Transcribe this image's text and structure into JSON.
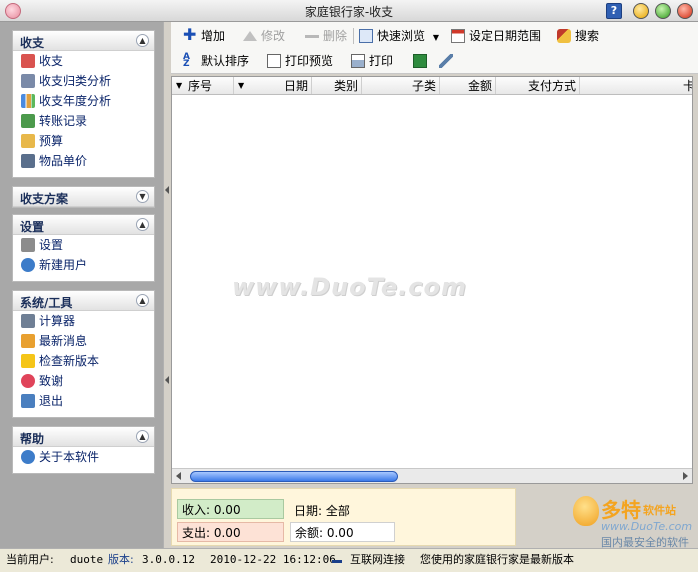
{
  "window": {
    "title": "家庭银行家-收支",
    "help_glyph": "?"
  },
  "sidebar": {
    "panels": [
      {
        "title": "收支",
        "items": [
          "收支",
          "收支归类分析",
          "收支年度分析",
          "转账记录",
          "预算",
          "物品单价"
        ]
      },
      {
        "title": "收支方案",
        "items": []
      },
      {
        "title": "设置",
        "items": [
          "设置",
          "新建用户"
        ]
      },
      {
        "title": "系统/工具",
        "items": [
          "计算器",
          "最新消息",
          "检查新版本",
          "致谢",
          "退出"
        ]
      },
      {
        "title": "帮助",
        "items": [
          "关于本软件"
        ]
      }
    ]
  },
  "toolbar": {
    "add": "增加",
    "edit": "修改",
    "delete": "删除",
    "quick_browse": "快速浏览",
    "date_range": "设定日期范围",
    "search": "搜索",
    "default_sort": "默认排序",
    "print_preview": "打印预览",
    "print": "打印"
  },
  "grid": {
    "columns": [
      "序号",
      "日期",
      "类别",
      "子类",
      "金额",
      "支付方式",
      "卡种"
    ]
  },
  "watermark": "www.DuoTe.com",
  "summary": {
    "income": "收入: 0.00",
    "expense": "支出: 0.00",
    "date": "日期: 全部",
    "balance": "余额: 0.00"
  },
  "logo": {
    "name": "多特",
    "sub": "软件站",
    "url": "www.DuoTe.com",
    "slogan": "国内最安全的软件站"
  },
  "statusbar": {
    "user_label": "当前用户:",
    "user": "duote",
    "version_label": "版本:",
    "version": "3.0.0.12",
    "datetime": "2010-12-22 16:12:06",
    "connection": "互联网连接",
    "message": "您使用的家庭银行家是最新版本"
  },
  "colors": {
    "link": "#0a2469",
    "accent": "#2b5bb8"
  }
}
